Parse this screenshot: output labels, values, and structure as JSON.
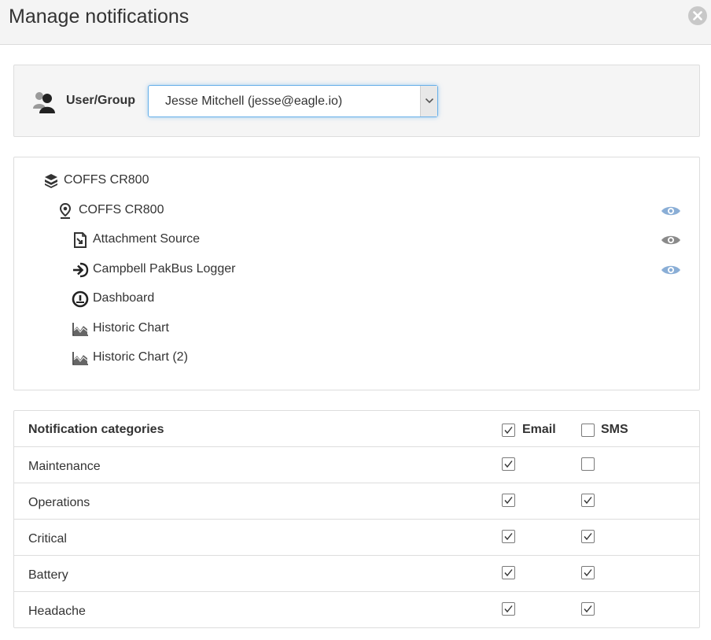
{
  "dialog": {
    "title": "Manage notifications",
    "close_icon": "close-circle-icon"
  },
  "user_group": {
    "label": "User/Group",
    "icon": "users-icon",
    "selected": "Jesse Mitchell (jesse@eagle.io)"
  },
  "tree": {
    "items": [
      {
        "label": "COFFS CR800",
        "icon": "box-stack-icon",
        "level": 0,
        "watch": null
      },
      {
        "label": "COFFS CR800",
        "icon": "location-pin-icon",
        "level": 1,
        "watch": "active"
      },
      {
        "label": "Attachment Source",
        "icon": "attachment-source-icon",
        "level": 2,
        "watch": "inactive"
      },
      {
        "label": "Campbell PakBus Logger",
        "icon": "sign-in-arrow-icon",
        "level": 2,
        "watch": "active"
      },
      {
        "label": "Dashboard",
        "icon": "dashboard-gauge-icon",
        "level": 2,
        "watch": null
      },
      {
        "label": "Historic Chart",
        "icon": "area-chart-icon",
        "level": 2,
        "watch": null
      },
      {
        "label": "Historic Chart (2)",
        "icon": "area-chart-icon",
        "level": 2,
        "watch": null
      }
    ]
  },
  "categories": {
    "header": {
      "label": "Notification categories",
      "email_label": "Email",
      "sms_label": "SMS",
      "email_all": true,
      "sms_all": false
    },
    "rows": [
      {
        "name": "Maintenance",
        "email": true,
        "sms": false
      },
      {
        "name": "Operations",
        "email": true,
        "sms": true
      },
      {
        "name": "Critical",
        "email": true,
        "sms": true
      },
      {
        "name": "Battery",
        "email": true,
        "sms": true
      },
      {
        "name": "Headache",
        "email": true,
        "sms": true
      }
    ]
  },
  "colors": {
    "eye_active": "#8aaed6",
    "eye_inactive": "#8a8a8a",
    "focus_border": "#66afe9"
  }
}
